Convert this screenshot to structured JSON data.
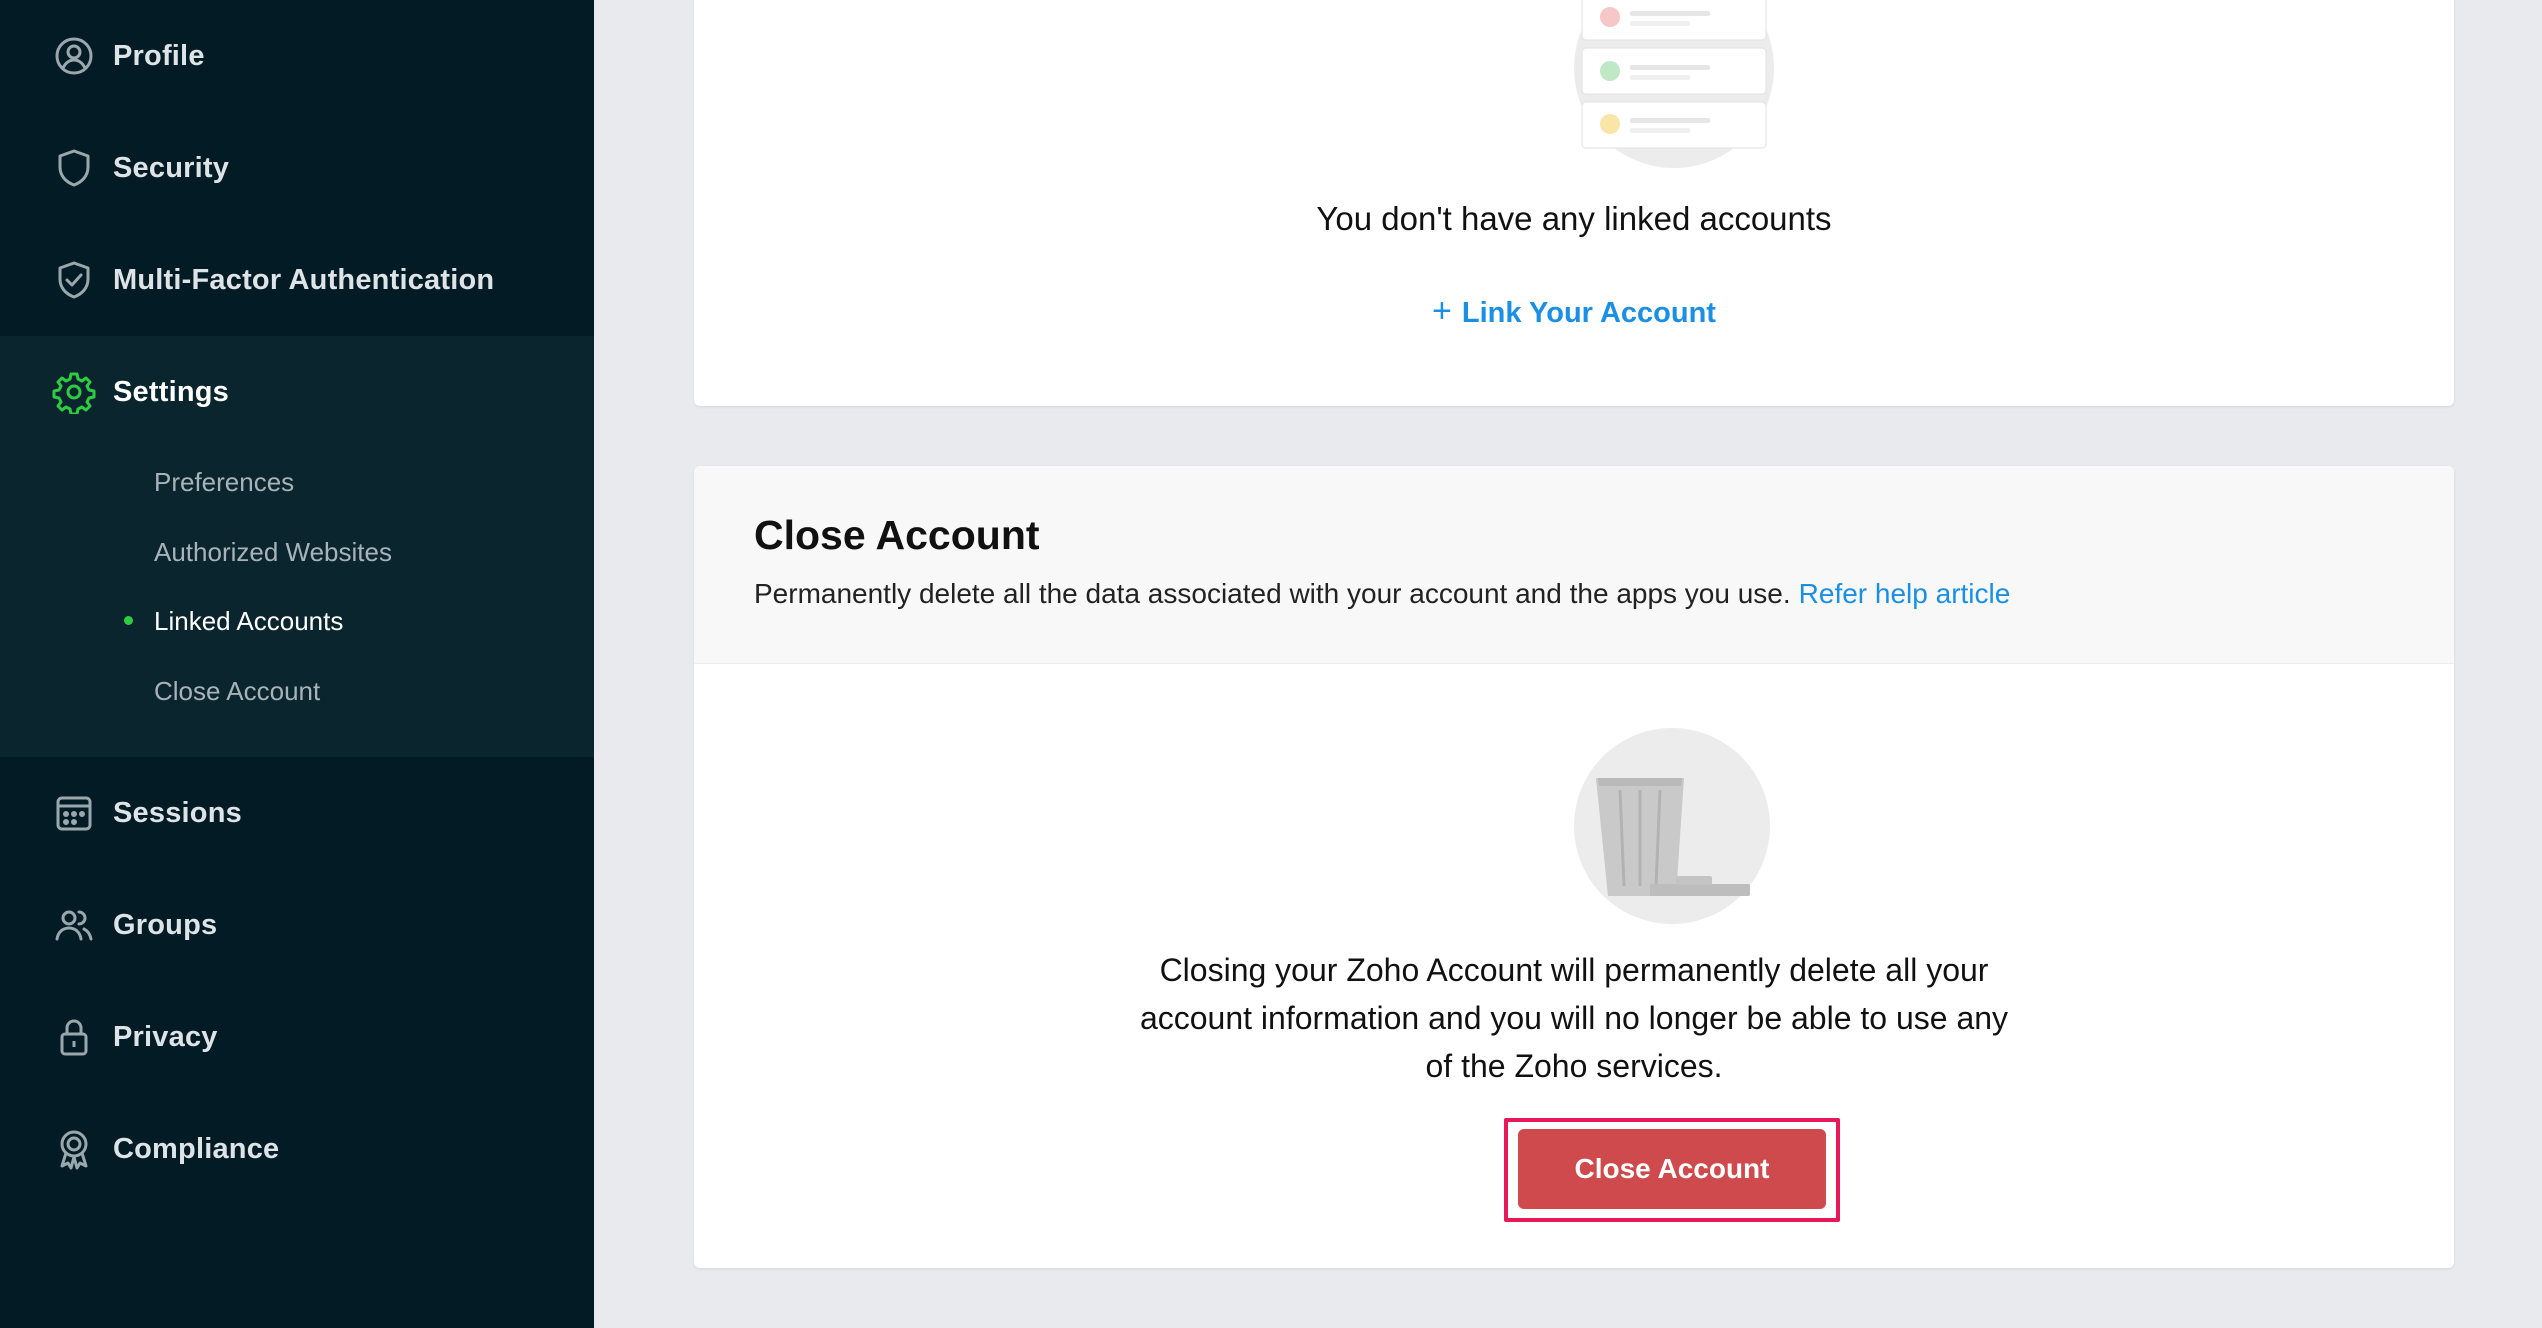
{
  "sidebar": {
    "items": [
      {
        "label": "Profile",
        "icon": "user-circle-icon"
      },
      {
        "label": "Security",
        "icon": "shield-icon"
      },
      {
        "label": "Multi-Factor Authentication",
        "icon": "shield-check-icon"
      },
      {
        "label": "Settings",
        "icon": "gear-icon"
      },
      {
        "label": "Sessions",
        "icon": "calendar-icon"
      },
      {
        "label": "Groups",
        "icon": "users-icon"
      },
      {
        "label": "Privacy",
        "icon": "lock-icon"
      },
      {
        "label": "Compliance",
        "icon": "badge-icon"
      }
    ],
    "active": "Settings",
    "settings_subitems": [
      "Preferences",
      "Authorized Websites",
      "Linked Accounts",
      "Close Account"
    ],
    "active_subitem": "Linked Accounts"
  },
  "linked_accounts": {
    "empty_text": "You don't have any linked accounts",
    "link_label": "Link Your Account",
    "link_icon": "plus-icon"
  },
  "close_account": {
    "title": "Close Account",
    "description": "Permanently delete all the data associated with your account and the apps you use.",
    "help_link": "Refer help article",
    "message": "Closing your Zoho Account will permanently delete all your account information and you will no longer be able to use any of the Zoho services.",
    "button_label": "Close Account",
    "illustration_icon": "trash-icon"
  },
  "colors": {
    "sidebar_bg": "#021b24",
    "accent_green": "#2ecc40",
    "link_blue": "#1a8fe3",
    "danger": "#cf4a4d",
    "highlight": "#e8185a"
  }
}
